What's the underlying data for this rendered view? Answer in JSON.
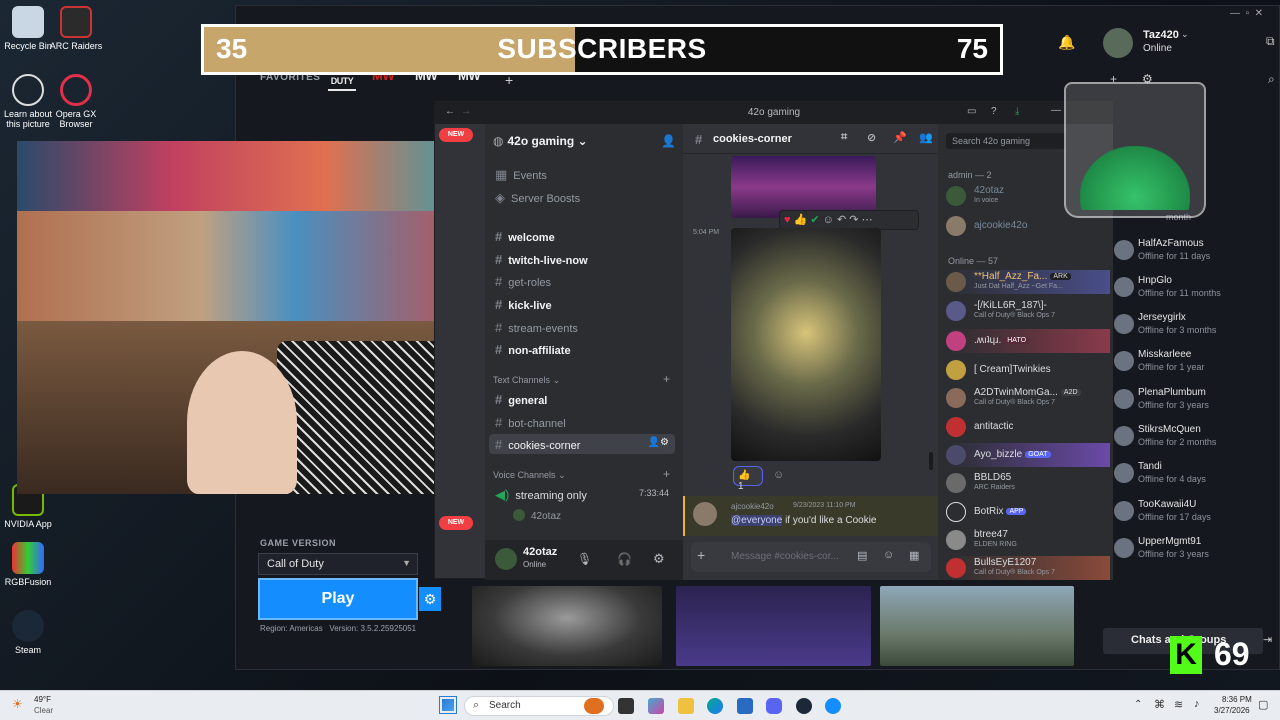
{
  "desktop": {
    "icons": [
      {
        "label": "Recycle Bin"
      },
      {
        "label": "ARC Raiders"
      },
      {
        "label": "Learn about this picture"
      },
      {
        "label": "Opera GX Browser"
      },
      {
        "label": "NVIDIA App"
      },
      {
        "label": "RGBFusion"
      },
      {
        "label": "Steam"
      }
    ]
  },
  "subscriber_goal": {
    "current": "35",
    "title": "SUBSCRIBERS",
    "goal": "75",
    "progress_fraction": 0.4667
  },
  "battlenet": {
    "favorites_label": "FAVORITES",
    "game_logos": [
      "CALL DUTY",
      "MW",
      "MW",
      "MW"
    ],
    "add_icon": "plus-icon",
    "user": {
      "name": "Taz420",
      "status": "Online"
    },
    "game_version_label": "GAME VERSION",
    "game_version_value": "Call of Duty",
    "play_label": "Play",
    "region_text": "Region: Americas",
    "version_text": "Version: 3.5.2.25925051",
    "chats_button": "Chats and Groups",
    "friends": [
      {
        "name": "HalfAzFamous",
        "status": "Offline for 11 days"
      },
      {
        "name": "HnpGlo",
        "status": "Offline for 11 months"
      },
      {
        "name": "Jerseygirlx",
        "status": "Offline for 3 months"
      },
      {
        "name": "Misskarleee",
        "status": "Offline for 1 year"
      },
      {
        "name": "PlenaPlumbum",
        "status": "Offline for 3 years"
      },
      {
        "name": "StikrsMcQuen",
        "status": "Offline for 2 months"
      },
      {
        "name": "Tandi",
        "status": "Offline for 4 days"
      },
      {
        "name": "TooKawaii4U",
        "status": "Offline for 17 days"
      },
      {
        "name": "UpperMgmt91",
        "status": "Offline for 3 years"
      }
    ],
    "friends_partial": "month"
  },
  "counter_overlay": {
    "value": "69"
  },
  "discord": {
    "window_title": "42o gaming",
    "server_name": "42o gaming",
    "new_badge": "NEW",
    "top_items": [
      "Events",
      "Server Boosts"
    ],
    "channels": [
      {
        "name": "welcome",
        "bold": true
      },
      {
        "name": "twitch-live-now",
        "bold": true
      },
      {
        "name": "get-roles",
        "bold": false
      },
      {
        "name": "kick-live",
        "bold": true
      },
      {
        "name": "stream-events",
        "bold": false
      },
      {
        "name": "non-affiliate",
        "bold": true
      }
    ],
    "text_category": "Text Channels",
    "text_channels": [
      {
        "name": "general",
        "bold": true
      },
      {
        "name": "bot-channel",
        "bold": false
      },
      {
        "name": "cookies-corner",
        "bold": false
      }
    ],
    "voice_category": "Voice Channels",
    "voice_channel": {
      "name": "streaming only",
      "timer": "7:33:44",
      "member": "42otaz"
    },
    "current_user": {
      "name": "42otaz",
      "status": "Online"
    },
    "chat": {
      "channel": "cookies-corner",
      "search_placeholder": "Search 42o gaming",
      "timestamp": "5:04 PM",
      "reaction_count": "1",
      "msg_author": "ajcookie42o",
      "msg_time": "9/23/2023 11:10 PM",
      "msg_mention": "@everyone",
      "msg_text": " if you'd like a Cookie",
      "input_placeholder": "Message #cookies-cor..."
    },
    "members": {
      "admin_header": "admin — 2",
      "admins": [
        {
          "name": "42otaz",
          "status": "In voice"
        },
        {
          "name": "ajcookie42o",
          "status": ""
        }
      ],
      "online_header": "Online — 57",
      "online": [
        {
          "name": "**Half_Azz_Fa...",
          "status": "Just Dat Half_Azz ~Get Fa...",
          "badge": "ARK"
        },
        {
          "name": "-[/KiLL6R_187\\]-",
          "status": "Call of Duty® Black Ops 7",
          "badge": ""
        },
        {
          "name": ".ʍıʇɥɹ.",
          "status": "",
          "badge": "HATO"
        },
        {
          "name": "[ Cream]Twinkies",
          "status": "",
          "badge": ""
        },
        {
          "name": "A2DTwinMomGa...",
          "status": "Call of Duty® Black Ops 7",
          "badge": "A2D"
        },
        {
          "name": "antitactic",
          "status": "",
          "badge": ""
        },
        {
          "name": "Ayo_bizzle",
          "status": "",
          "badge": "GOAT"
        },
        {
          "name": "BBLD65",
          "status": "ARC Raiders",
          "badge": ""
        },
        {
          "name": "BotRix",
          "status": "",
          "badge": "APP"
        },
        {
          "name": "btree47",
          "status": "ELDEN RING",
          "badge": ""
        },
        {
          "name": "BullsEyE1207",
          "status": "Call of Duty® Black Ops 7",
          "badge": ""
        }
      ]
    }
  },
  "taskbar": {
    "weather_temp": "49°F",
    "weather_desc": "Clear",
    "search_placeholder": "Search",
    "time": "8:36 PM",
    "date": "3/27/2026"
  }
}
